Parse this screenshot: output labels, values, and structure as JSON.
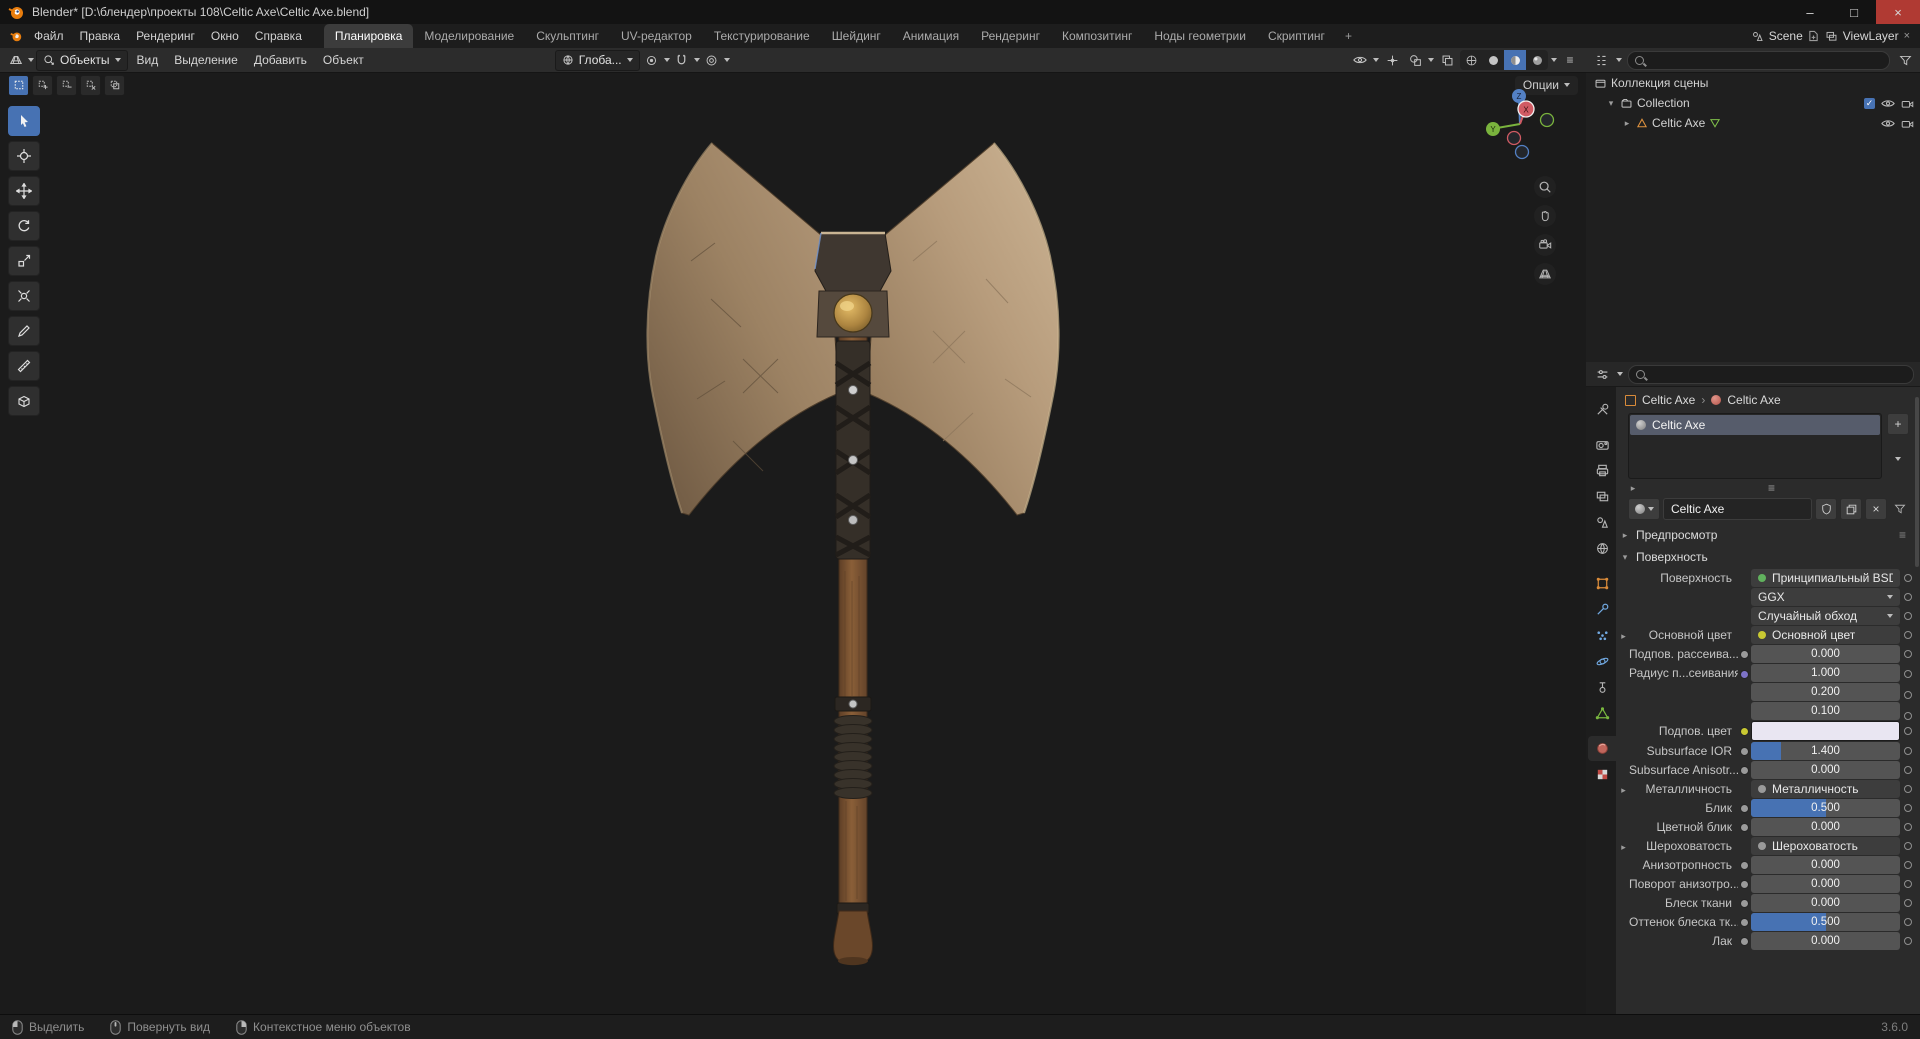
{
  "titlebar": {
    "title": "Blender* [D:\\блендер\\проекты 108\\Celtic Axe\\Celtic Axe.blend]",
    "minimize": "–",
    "maximize": "□",
    "close": "×"
  },
  "topbar": {
    "menus": [
      "Файл",
      "Правка",
      "Рендеринг",
      "Окно",
      "Справка"
    ],
    "workspaces": [
      "Планировка",
      "Моделирование",
      "Скульптинг",
      "UV-редактор",
      "Текстурирование",
      "Шейдинг",
      "Анимация",
      "Рендеринг",
      "Композитинг",
      "Ноды геометрии",
      "Скриптинг"
    ],
    "add_tab": "+",
    "scene_label": "Scene",
    "viewlayer_label": "ViewLayer"
  },
  "viewport": {
    "mode": "Объекты",
    "menus": [
      "Вид",
      "Выделение",
      "Добавить",
      "Объект"
    ],
    "orientation": "Глоба...",
    "options_label": "Опции",
    "gizmo": {
      "x": "X",
      "y": "Y",
      "z": "Z"
    }
  },
  "outliner": {
    "scene_collection": "Коллекция сцены",
    "collection": "Collection",
    "object": "Celtic Axe"
  },
  "properties": {
    "breadcrumb": {
      "object": "Celtic Axe",
      "sep": "›",
      "material": "Celtic Axe"
    },
    "slot_name": "Celtic Axe",
    "material_name": "Celtic Axe",
    "preview_section": "Предпросмотр",
    "surface_section": "Поверхность",
    "rows": [
      {
        "label": "Поверхность",
        "value": "Принципиальный BSDF"
      },
      {
        "label": "",
        "value": "GGX"
      },
      {
        "label": "",
        "value": "Случайный обход"
      },
      {
        "label": "Основной цвет",
        "value": "Основной цвет"
      },
      {
        "label": "Подпов. рассеива...",
        "value": "0.000",
        "fill": 0
      },
      {
        "label": "Радиус п...сеивания",
        "values": [
          "1.000",
          "0.200",
          "0.100"
        ]
      },
      {
        "label": "Подпов. цвет",
        "swatch": "#e9e6f2"
      },
      {
        "label": "Subsurface IOR",
        "value": "1.400",
        "fill": 0.2
      },
      {
        "label": "Subsurface Anisotr...",
        "value": "0.000",
        "fill": 0
      },
      {
        "label": "Металличность",
        "value": "Металличность"
      },
      {
        "label": "Блик",
        "value": "0.500",
        "fill": 0.5
      },
      {
        "label": "Цветной блик",
        "value": "0.000",
        "fill": 0
      },
      {
        "label": "Шероховатость",
        "value": "Шероховатость"
      },
      {
        "label": "Анизотропность",
        "value": "0.000",
        "fill": 0
      },
      {
        "label": "Поворот анизотро...",
        "value": "0.000",
        "fill": 0
      },
      {
        "label": "Блеск ткани",
        "value": "0.000",
        "fill": 0
      },
      {
        "label": "Оттенок блеска тк...",
        "value": "0.500",
        "fill": 0.5
      },
      {
        "label": "Лак",
        "value": "0.000",
        "fill": 0
      }
    ]
  },
  "statusbar": {
    "hint_left": "Выделить",
    "hint_middle": "Повернуть вид",
    "hint_right": "Контекстное меню объектов",
    "version": "3.6.0"
  },
  "icons": {
    "chevron": "▾",
    "expander_closed": "▸",
    "expander_open": "▾",
    "add": "+",
    "close": "×",
    "menu_grip": "≡",
    "check": "✓"
  },
  "colors": {
    "accent": "#4772b3",
    "slider_bg": "#545454"
  }
}
